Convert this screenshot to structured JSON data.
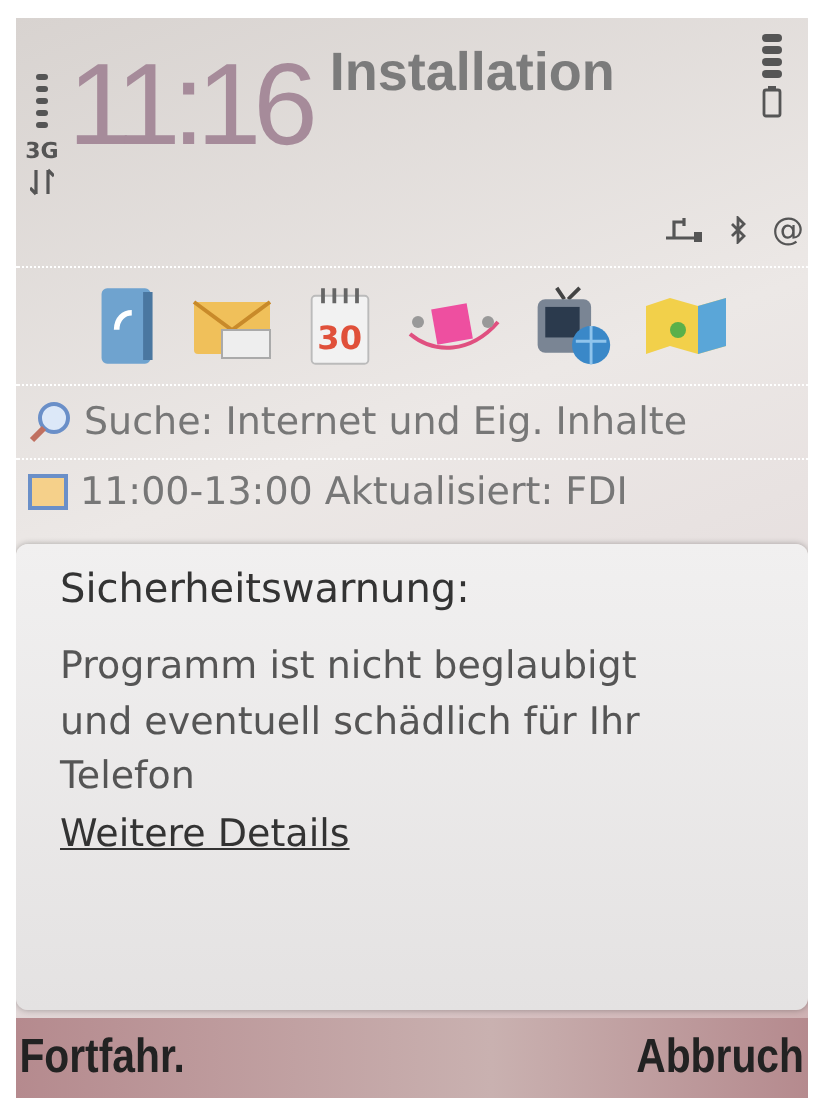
{
  "status_bar": {
    "network": "3G",
    "time": "11:16",
    "title": "Installation",
    "email_indicator": "@"
  },
  "shortcuts": {
    "calendar_day": "30"
  },
  "search": {
    "label": "Suche: Internet und Eig. Inhalte"
  },
  "agenda_row": {
    "text": "11:00-13:00 Aktualisiert: FDI"
  },
  "dialog": {
    "title": "Sicherheitswarnung:",
    "message": "Programm ist nicht beglaubigt und eventuell schädlich für Ihr Telefon",
    "link": "Weitere Details"
  },
  "softkeys": {
    "left": "Fortfahr.",
    "right": "Abbruch"
  }
}
